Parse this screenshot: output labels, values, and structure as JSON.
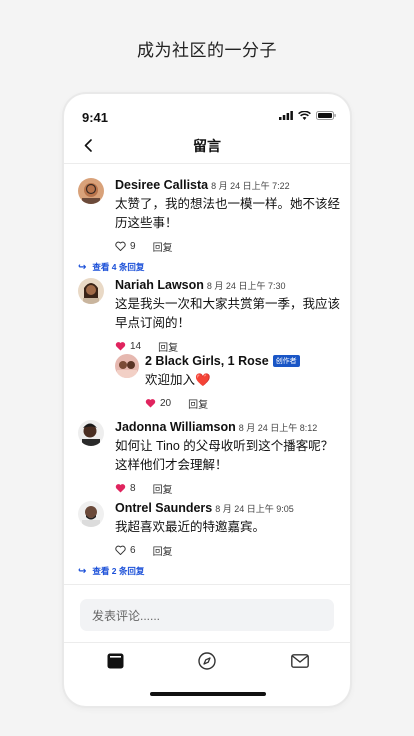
{
  "headline": "成为社区的一分子",
  "status": {
    "time": "9:41"
  },
  "nav": {
    "title": "留言"
  },
  "comments": [
    {
      "name": "Desiree Callista",
      "date": "8 月 24 日上午 7:22",
      "text": "太赞了，我的想法也一模一样。她不该经历这些事！",
      "likes": "9",
      "liked": false,
      "reply_label": "回复",
      "view_replies": "查看 4 条回复"
    },
    {
      "name": "Nariah Lawson",
      "date": "8 月 24 日上午 7:30",
      "text": " 这是我头一次和大家共赏第一季，我应该早点订阅的！",
      "likes": "14",
      "liked": true,
      "reply_label": "回复"
    },
    {
      "name": "Jadonna Williamson",
      "date": "8 月 24 日上午 8:12",
      "text": "如何让 Tino 的父母收听到这个播客呢？这样他们才会理解！",
      "likes": "8",
      "liked": true,
      "reply_label": "回复"
    },
    {
      "name": "Ontrel Saunders",
      "date": "8 月 24 日上午 9:05",
      "text": " 我超喜欢最近的特邀嘉宾。",
      "likes": "6",
      "liked": false,
      "reply_label": "回复",
      "view_replies": "查看 2 条回复"
    }
  ],
  "reply": {
    "name": "2 Black Girls, 1 Rose",
    "badge": "创作者",
    "text": "欢迎加入❤️",
    "likes": "20",
    "liked": true,
    "reply_label": "回复"
  },
  "composer": {
    "placeholder": "发表评论......"
  },
  "colors": {
    "accent": "#1a56c6",
    "like": "#e0245e"
  },
  "tabs": [
    "library-icon",
    "compass-icon",
    "mail-icon"
  ]
}
